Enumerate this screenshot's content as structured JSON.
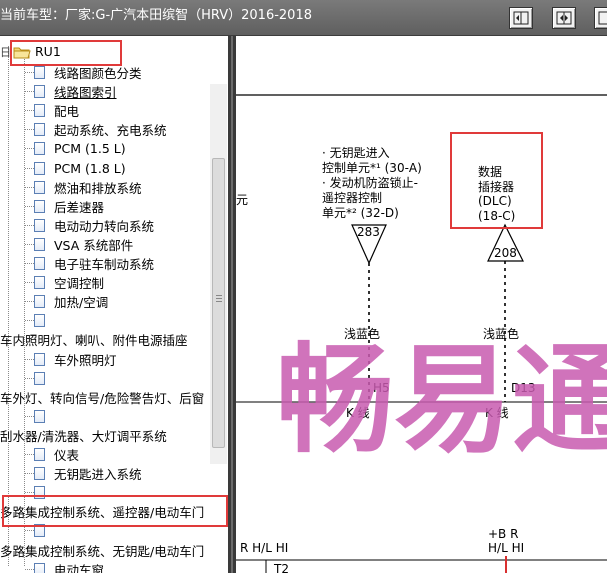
{
  "title_bar": {
    "text": "当前车型：厂家:G-广汽本田缤智（HRV）2016-2018",
    "buttons": [
      {
        "icon": "collapse-left-icon"
      },
      {
        "icon": "expand-icon"
      },
      {
        "icon": "collapse-right-icon"
      }
    ]
  },
  "tree": {
    "root": {
      "label": "RU1",
      "expander": "日",
      "icon": "folder-icon"
    },
    "items": [
      {
        "label": "线路图颜色分类"
      },
      {
        "label": "线路图索引"
      },
      {
        "label": "配电"
      },
      {
        "label": "起动系统、充电系统"
      },
      {
        "label": "PCM (1.5 L)"
      },
      {
        "label": "PCM (1.8 L)"
      },
      {
        "label": "燃油和排放系统"
      },
      {
        "label": "后差速器"
      },
      {
        "label": "电动动力转向系统"
      },
      {
        "label": "VSA 系统部件"
      },
      {
        "label": "电子驻车制动系统"
      },
      {
        "label": "空调控制"
      },
      {
        "label": "加热/空调"
      },
      {
        "label": ""
      },
      {
        "label": "车内照明灯、喇叭、附件电源插座"
      },
      {
        "label": "车外照明灯"
      },
      {
        "label": ""
      },
      {
        "label": "车外灯、转向信号/危险警告灯、后窗"
      },
      {
        "label": ""
      },
      {
        "label": "刮水器/清洗器、大灯调平系统"
      },
      {
        "label": "仪表"
      },
      {
        "label": "无钥匙进入系统"
      },
      {
        "label": ""
      },
      {
        "label": "多路集成控制系统、遥控器/电动车门"
      },
      {
        "label": ""
      },
      {
        "label": "多路集成控制系统、无钥匙/电动车门"
      },
      {
        "label": "电动车窗"
      }
    ]
  },
  "diagram": {
    "left_edge_text": "元",
    "left_component": {
      "lines": [
        "· 无钥匙进入",
        "控制单元*¹ (30-A)",
        "· 发动机防盗锁止-",
        "遥控器控制",
        "单元*² (32-D)"
      ],
      "connector": "283",
      "wire_color": "浅蓝色",
      "pin": "H5",
      "line_label": "K 线"
    },
    "right_component": {
      "lines": [
        "数据",
        "插接器",
        "(DLC)",
        "(18-C)"
      ],
      "connector": "208",
      "wire_color": "浅蓝色",
      "pin": "D13",
      "line_label": "K 线"
    },
    "bottom": {
      "left_label": "R H/L HI",
      "left_sub": "T2",
      "right_label_1": "+B R",
      "right_label_2": "H/L HI"
    },
    "watermark": "畅易通",
    "accent_red": "#e03a3a",
    "watermark_color": "#c85bb0"
  }
}
